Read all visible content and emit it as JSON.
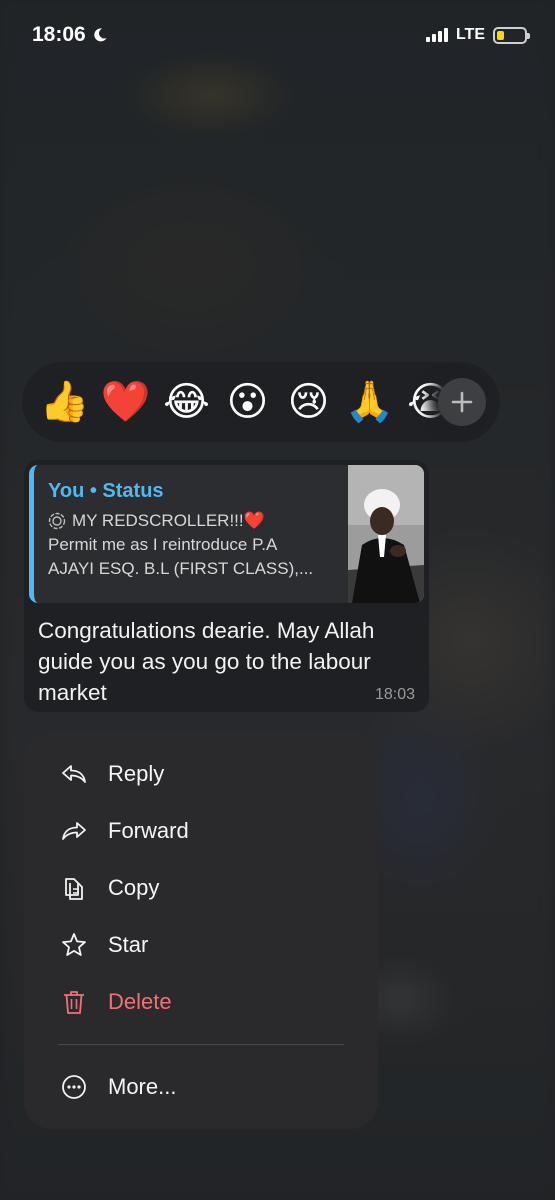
{
  "status_bar": {
    "time": "18:06",
    "network": "LTE"
  },
  "reactions": {
    "emojis": [
      "👍",
      "❤️",
      "😂",
      "😮",
      "😢",
      "🙏",
      "😭"
    ],
    "add_label": "+"
  },
  "message": {
    "quote": {
      "title": "You • Status",
      "line1": "MY REDSCROLLER!!!❤️",
      "line2": "Permit me as I reintroduce P.A",
      "line3": "AJAYI ESQ. B.L (FIRST CLASS),..."
    },
    "text": "Congratulations dearie. May Allah guide you as you go to the labour market",
    "time": "18:03"
  },
  "menu": {
    "reply": "Reply",
    "forward": "Forward",
    "copy": "Copy",
    "star": "Star",
    "delete": "Delete",
    "more": "More..."
  },
  "colors": {
    "accent": "#53b7f0",
    "danger": "#f0707a"
  }
}
